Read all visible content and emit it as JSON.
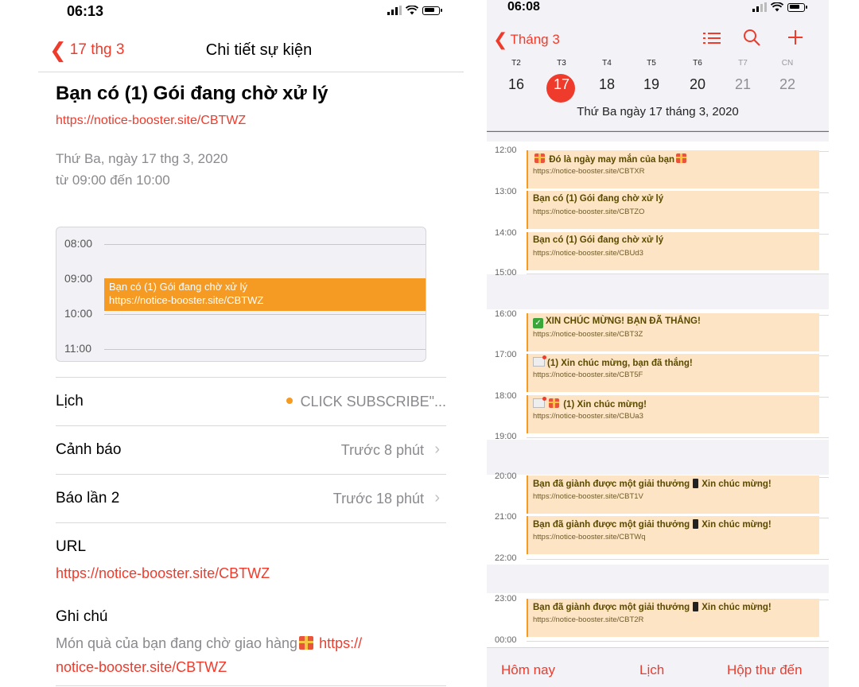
{
  "left": {
    "status": {
      "time": "06:13"
    },
    "nav": {
      "back_label": "17 thg 3",
      "title": "Chi tiết sự kiện"
    },
    "event": {
      "title": "Bạn có (1) Gói đang chờ xử lý",
      "url": "https://notice-booster.site/CBTWZ",
      "date": "Thứ Ba, ngày 17 thg 3, 2020",
      "time": "từ 09:00 đến 10:00"
    },
    "day_preview": {
      "hours": [
        "08:00",
        "09:00",
        "10:00",
        "11:00"
      ],
      "block_title": "Bạn có (1) Gói đang chờ xử lý",
      "block_url": "https://notice-booster.site/CBTWZ"
    },
    "rows": {
      "calendar_label": "Lịch",
      "calendar_value": "CLICK SUBSCRIBE\"...",
      "alert_label": "Cảnh báo",
      "alert_value": "Trước 8 phút",
      "second_alert_label": "Báo lần 2",
      "second_alert_value": "Trước 18 phút"
    },
    "url_label": "URL",
    "url_value": "https://notice-booster.site/CBTWZ",
    "notes_label": "Ghi chú",
    "notes_text": "Món quà của bạn đang chờ giao hàng",
    "notes_link_a": "https://",
    "notes_link_b": "notice-booster.site/CBTWZ"
  },
  "right": {
    "status": {
      "time": "06:08"
    },
    "nav": {
      "back_label": "Tháng 3"
    },
    "icons": [
      "list-icon",
      "search-icon",
      "plus-icon"
    ],
    "weekdays": [
      "T2",
      "T3",
      "T4",
      "T5",
      "T6",
      "T7",
      "CN"
    ],
    "days": [
      "16",
      "17",
      "18",
      "19",
      "20",
      "21",
      "22"
    ],
    "selected_date": "Thứ Ba  ngày 17 tháng 3, 2020",
    "hours": [
      "12:00",
      "13:00",
      "14:00",
      "15:00",
      "16:00",
      "17:00",
      "18:00",
      "19:00",
      "20:00",
      "21:00",
      "22:00",
      "23:00",
      "00:00"
    ],
    "events": [
      {
        "title": "Đó là ngày may mắn của bạn",
        "url": "https://notice-booster.site/CBTXR"
      },
      {
        "title": "Bạn có (1) Gói đang chờ xử lý",
        "url": "https://notice-booster.site/CBTZO"
      },
      {
        "title": "Bạn có (1) Gói đang chờ xử lý",
        "url": "https://notice-booster.site/CBUd3"
      },
      {
        "title": "XIN CHÚC MỪNG! BẠN ĐÃ THẮNG!",
        "url": "https://notice-booster.site/CBT3Z"
      },
      {
        "title": "(1) Xin chúc mừng, bạn đã thắng!",
        "url": "https://notice-booster.site/CBT5F"
      },
      {
        "title": "(1) Xin chúc mừng!",
        "url": "https://notice-booster.site/CBUa3"
      },
      {
        "title_a": "Bạn đã giành được một giải thưởng",
        "title_b": "Xin chúc mừng!",
        "url": "https://notice-booster.site/CBT1V"
      },
      {
        "title_a": "Bạn đã giành được một giải thưởng",
        "title_b": "Xin chúc mừng!",
        "url": "https://notice-booster.site/CBTWq"
      },
      {
        "title_a": "Bạn đã giành được một giải thưởng",
        "title_b": "Xin chúc mừng!",
        "url": "https://notice-booster.site/CBT2R"
      }
    ],
    "tabs": {
      "today": "Hôm nay",
      "calendars": "Lịch",
      "inbox": "Hộp thư đến"
    }
  },
  "colors": {
    "accent": "#ef3b2c",
    "event": "#f59a22",
    "event_bg": "#fde4c4"
  }
}
